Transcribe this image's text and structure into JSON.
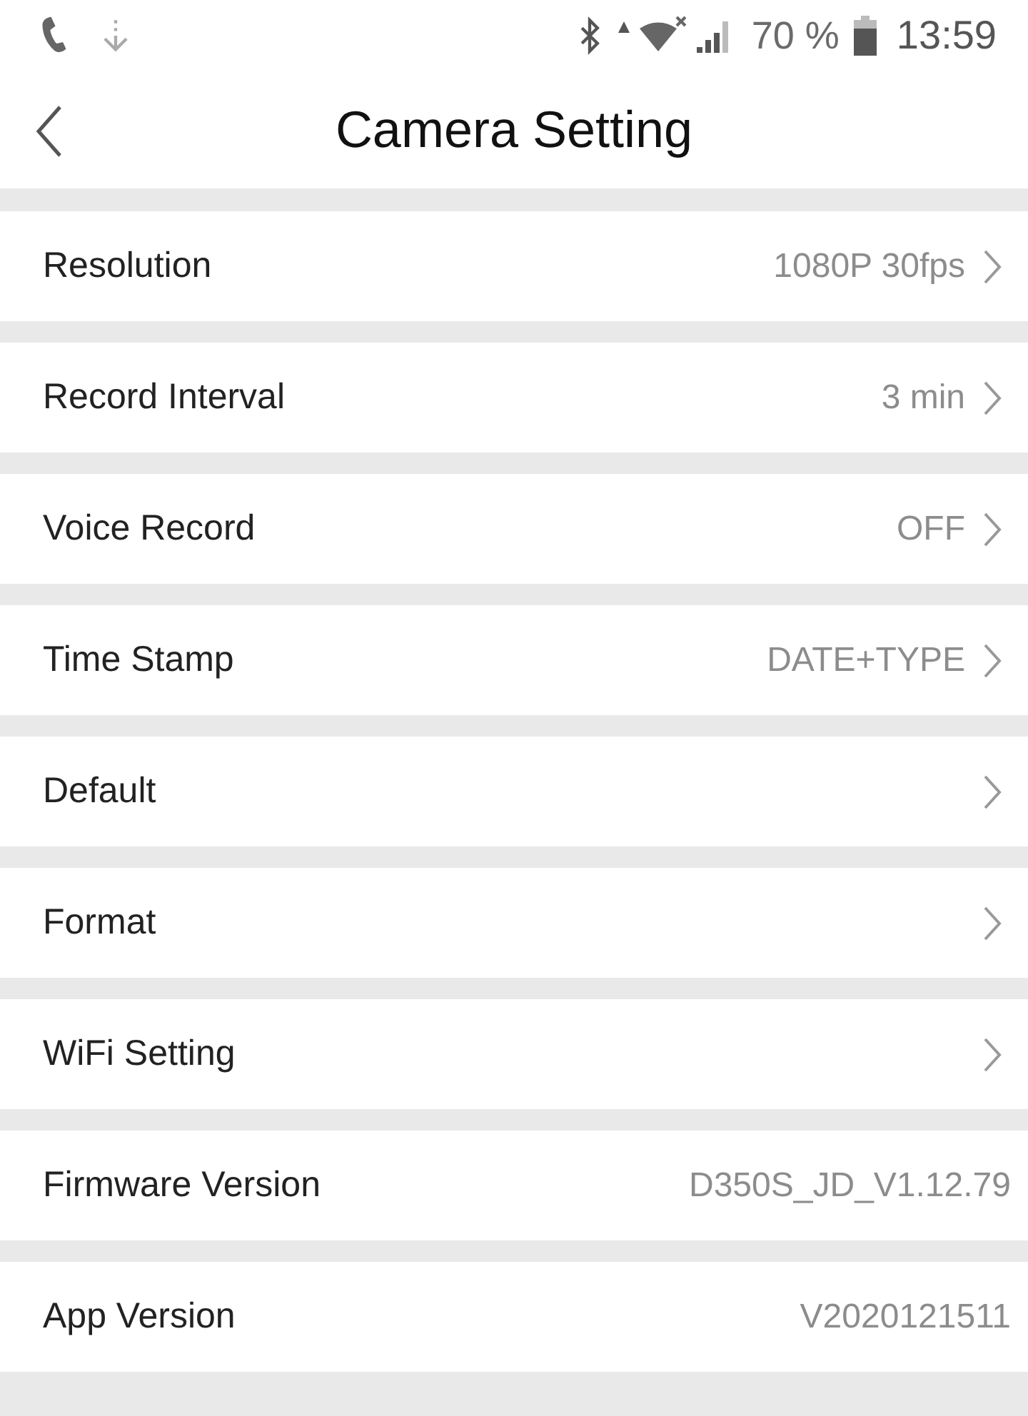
{
  "status_bar": {
    "battery": "70 %",
    "time": "13:59"
  },
  "header": {
    "title": "Camera Setting"
  },
  "settings": [
    {
      "label": "Resolution",
      "value": "1080P 30fps",
      "chevron": true
    },
    {
      "label": "Record Interval",
      "value": "3 min",
      "chevron": true
    },
    {
      "label": "Voice Record",
      "value": "OFF",
      "chevron": true
    },
    {
      "label": "Time Stamp",
      "value": "DATE+TYPE",
      "chevron": true
    },
    {
      "label": "Default",
      "chevron": true
    },
    {
      "label": "Format",
      "chevron": true
    },
    {
      "label": "WiFi Setting",
      "chevron": true
    },
    {
      "label": "Firmware Version",
      "value": "D350S_JD_V1.12.79",
      "chevron": false
    },
    {
      "label": "App Version",
      "value": "V2020121511",
      "chevron": false
    }
  ]
}
